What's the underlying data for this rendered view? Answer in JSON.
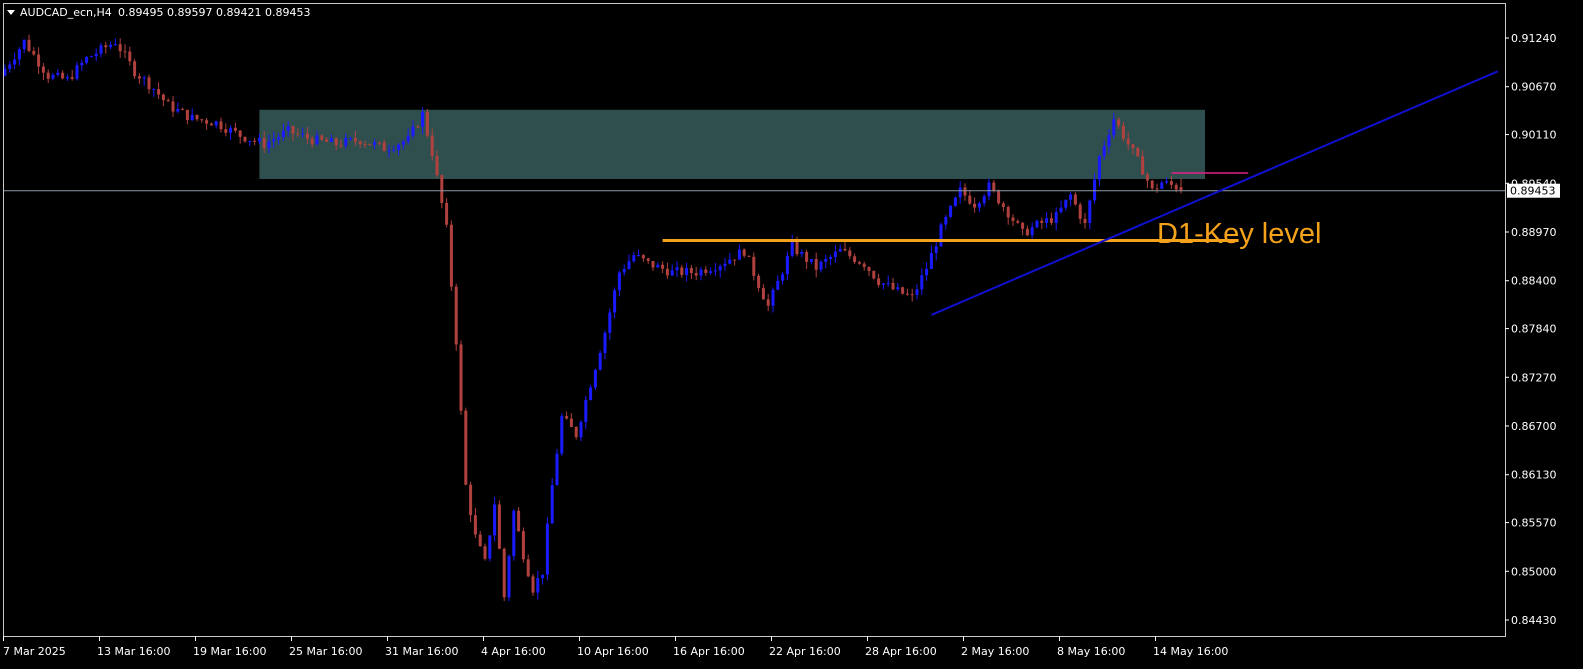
{
  "header": {
    "symbol_timeframe": "AUDCAD_ecn,H4",
    "ohlc": "0.89495 0.89597 0.89421 0.89453"
  },
  "colors": {
    "background": "#000000",
    "frame": "#c8c8c8",
    "bull": "#1a1aff",
    "bear": "#b0413e",
    "zone_fill": "#2f4f4f",
    "key_level": "#f5a21b",
    "trendline": "#1010d0",
    "price_line": "#8a9aa6",
    "magenta_line": "#e0208a",
    "text": "#ffffff"
  },
  "chart_data": {
    "type": "candlestick",
    "symbol": "AUDCAD_ecn",
    "timeframe": "H4",
    "ylim": [
      0.8443,
      0.9124
    ],
    "y_ticks": [
      "0.91240",
      "0.90670",
      "0.90110",
      "0.89540",
      "0.89453",
      "0.88970",
      "0.88400",
      "0.87840",
      "0.87270",
      "0.86700",
      "0.86130",
      "0.85570",
      "0.85000",
      "0.84430"
    ],
    "x_ticks": [
      "7 Mar 2025",
      "13 Mar 16:00",
      "19 Mar 16:00",
      "25 Mar 16:00",
      "31 Mar 16:00",
      "4 Apr 16:00",
      "10 Apr 16:00",
      "16 Apr 16:00",
      "22 Apr 16:00",
      "28 Apr 16:00",
      "2 May 16:00",
      "8 May 16:00",
      "14 May 16:00"
    ],
    "current_price": 0.89453,
    "last_ohlc": {
      "open": 0.89495,
      "high": 0.89597,
      "low": 0.89421,
      "close": 0.89453
    },
    "path_anchors": [
      [
        0,
        0.908
      ],
      [
        5,
        0.912
      ],
      [
        10,
        0.908
      ],
      [
        14,
        0.9075
      ],
      [
        18,
        0.91
      ],
      [
        24,
        0.912
      ],
      [
        28,
        0.9085
      ],
      [
        32,
        0.9065
      ],
      [
        35,
        0.9045
      ],
      [
        40,
        0.903
      ],
      [
        45,
        0.9025
      ],
      [
        50,
        0.901
      ],
      [
        55,
        0.9
      ],
      [
        60,
        0.9015
      ],
      [
        65,
        0.9005
      ],
      [
        70,
        0.9
      ],
      [
        75,
        0.9005
      ],
      [
        80,
        0.8995
      ],
      [
        85,
        0.9005
      ],
      [
        88,
        0.9035
      ],
      [
        90,
        0.899
      ],
      [
        93,
        0.89
      ],
      [
        95,
        0.877
      ],
      [
        97,
        0.86
      ],
      [
        99,
        0.854
      ],
      [
        101,
        0.851
      ],
      [
        103,
        0.858
      ],
      [
        105,
        0.847
      ],
      [
        107,
        0.857
      ],
      [
        109,
        0.852
      ],
      [
        111,
        0.848
      ],
      [
        113,
        0.85
      ],
      [
        115,
        0.86
      ],
      [
        117,
        0.868
      ],
      [
        120,
        0.866
      ],
      [
        123,
        0.872
      ],
      [
        126,
        0.878
      ],
      [
        129,
        0.885
      ],
      [
        132,
        0.887
      ],
      [
        135,
        0.886
      ],
      [
        140,
        0.885
      ],
      [
        145,
        0.885
      ],
      [
        150,
        0.886
      ],
      [
        155,
        0.8875
      ],
      [
        160,
        0.881
      ],
      [
        165,
        0.888
      ],
      [
        170,
        0.8855
      ],
      [
        175,
        0.8875
      ],
      [
        180,
        0.886
      ],
      [
        183,
        0.884
      ],
      [
        186,
        0.883
      ],
      [
        190,
        0.882
      ],
      [
        193,
        0.8855
      ],
      [
        196,
        0.89
      ],
      [
        200,
        0.8945
      ],
      [
        203,
        0.893
      ],
      [
        206,
        0.895
      ],
      [
        210,
        0.892
      ],
      [
        213,
        0.8895
      ],
      [
        216,
        0.8905
      ],
      [
        220,
        0.8915
      ],
      [
        223,
        0.894
      ],
      [
        226,
        0.8905
      ],
      [
        229,
        0.8985
      ],
      [
        232,
        0.903
      ],
      [
        235,
        0.9
      ],
      [
        238,
        0.897
      ],
      [
        240,
        0.8945
      ],
      [
        242,
        0.8955
      ],
      [
        245,
        0.895
      ]
    ],
    "zones": [
      {
        "name": "resistance-zone",
        "y0": 0.8959,
        "y1": 0.904,
        "x_start": 53,
        "x_end": 250
      }
    ],
    "horizontal_lines": [
      {
        "name": "D1-Key level",
        "y": 0.8887,
        "x_start": 137,
        "x_end": 257
      },
      {
        "name": "magenta-level",
        "y": 0.8966,
        "x_start": 243,
        "x_end": 259
      }
    ],
    "trendline": {
      "p1": [
        193,
        0.88
      ],
      "p2": [
        311,
        0.9085
      ]
    },
    "annotations": [
      {
        "text": "D1-Key level",
        "bar": 240,
        "y": 0.8897
      }
    ]
  }
}
